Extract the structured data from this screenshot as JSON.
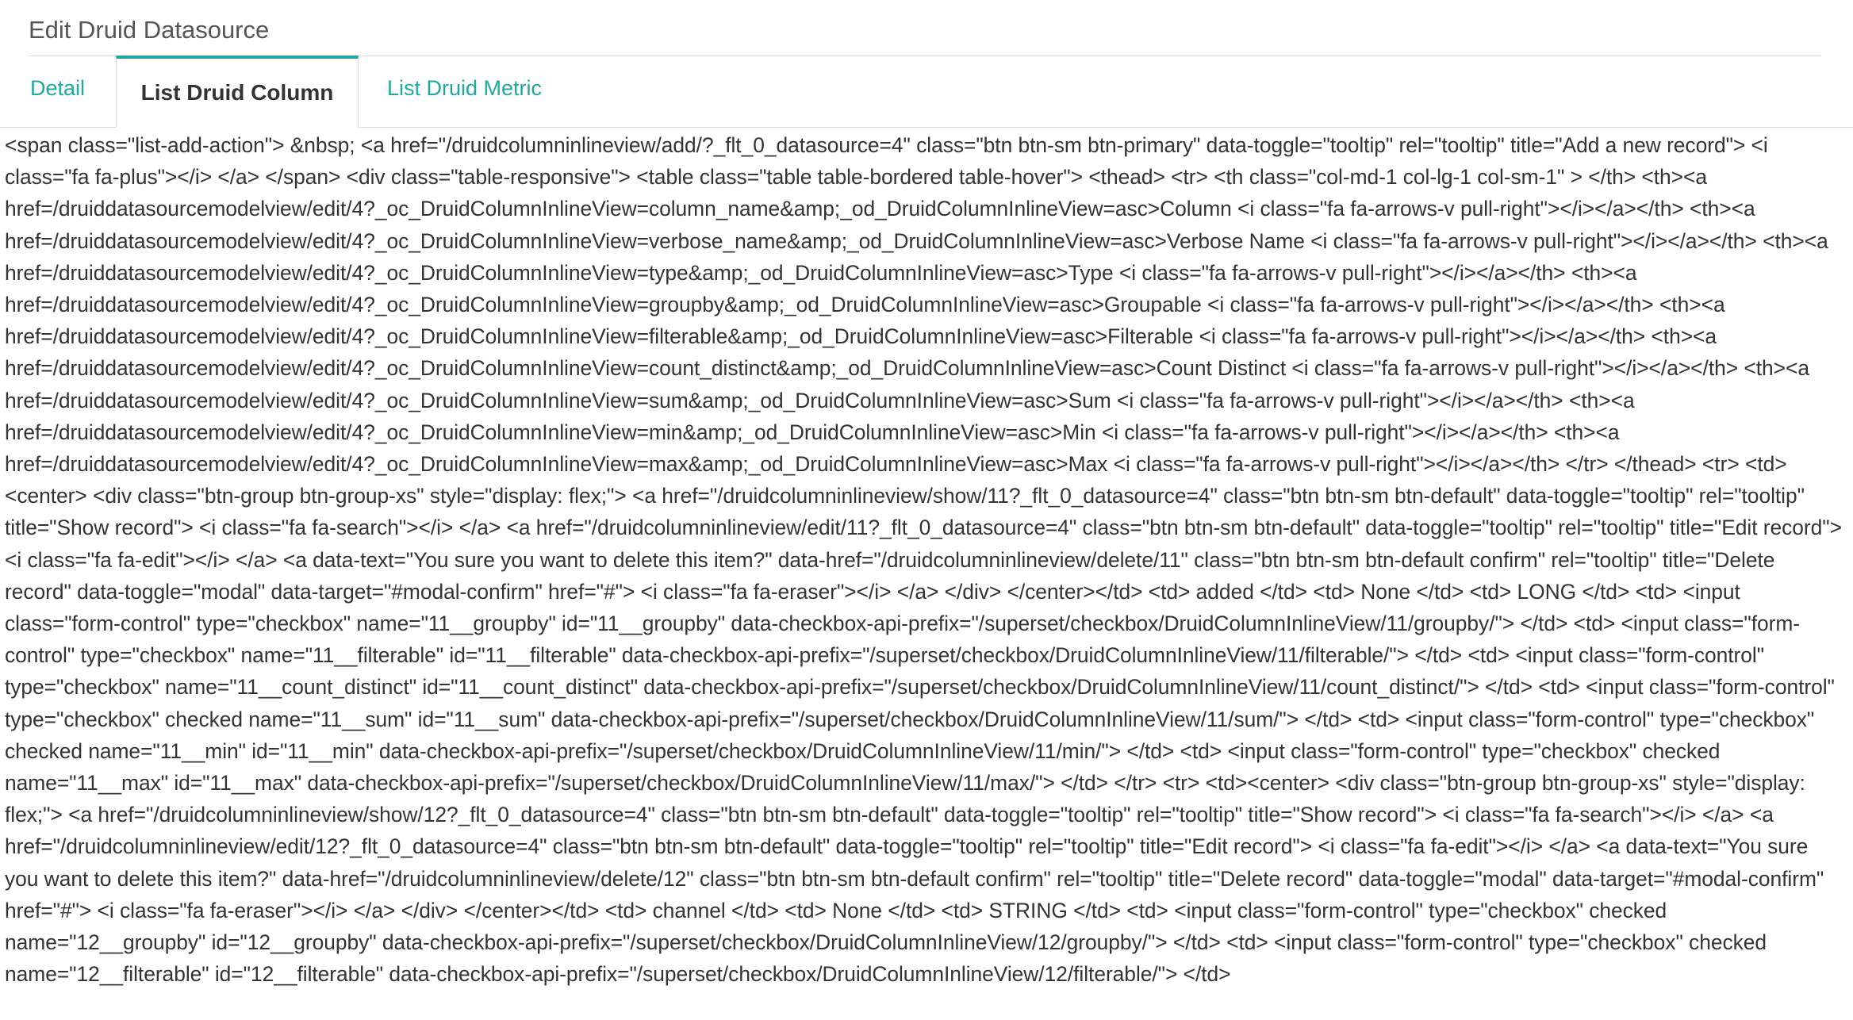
{
  "header": {
    "title": "Edit Druid Datasource"
  },
  "tabs": [
    {
      "label": "Detail"
    },
    {
      "label": "List Druid Column"
    },
    {
      "label": "List Druid Metric"
    }
  ],
  "active_tab": "List Druid Column",
  "accent_color": "#1fa8a0",
  "content": {
    "raw_html_text": "<span class=\"list-add-action\"> &nbsp; <a href=\"/druidcolumninlineview/add/?_flt_0_datasource=4\" class=\"btn btn-sm btn-primary\" data-toggle=\"tooltip\" rel=\"tooltip\" title=\"Add a new record\"> <i class=\"fa fa-plus\"></i> </a> </span> <div class=\"table-responsive\"> <table class=\"table table-bordered table-hover\"> <thead> <tr> <th class=\"col-md-1 col-lg-1 col-sm-1\" > </th> <th><a href=/druiddatasourcemodelview/edit/4?_oc_DruidColumnInlineView=column_name&amp;_od_DruidColumnInlineView=asc>Column <i class=\"fa fa-arrows-v pull-right\"></i></a></th> <th><a href=/druiddatasourcemodelview/edit/4?_oc_DruidColumnInlineView=verbose_name&amp;_od_DruidColumnInlineView=asc>Verbose Name <i class=\"fa fa-arrows-v pull-right\"></i></a></th> <th><a href=/druiddatasourcemodelview/edit/4?_oc_DruidColumnInlineView=type&amp;_od_DruidColumnInlineView=asc>Type <i class=\"fa fa-arrows-v pull-right\"></i></a></th> <th><a href=/druiddatasourcemodelview/edit/4?_oc_DruidColumnInlineView=groupby&amp;_od_DruidColumnInlineView=asc>Groupable <i class=\"fa fa-arrows-v pull-right\"></i></a></th> <th><a href=/druiddatasourcemodelview/edit/4?_oc_DruidColumnInlineView=filterable&amp;_od_DruidColumnInlineView=asc>Filterable <i class=\"fa fa-arrows-v pull-right\"></i></a></th> <th><a href=/druiddatasourcemodelview/edit/4?_oc_DruidColumnInlineView=count_distinct&amp;_od_DruidColumnInlineView=asc>Count Distinct <i class=\"fa fa-arrows-v pull-right\"></i></a></th> <th><a href=/druiddatasourcemodelview/edit/4?_oc_DruidColumnInlineView=sum&amp;_od_DruidColumnInlineView=asc>Sum <i class=\"fa fa-arrows-v pull-right\"></i></a></th> <th><a href=/druiddatasourcemodelview/edit/4?_oc_DruidColumnInlineView=min&amp;_od_DruidColumnInlineView=asc>Min <i class=\"fa fa-arrows-v pull-right\"></i></a></th> <th><a href=/druiddatasourcemodelview/edit/4?_oc_DruidColumnInlineView=max&amp;_od_DruidColumnInlineView=asc>Max <i class=\"fa fa-arrows-v pull-right\"></i></a></th> </tr> </thead> <tr> <td><center> <div class=\"btn-group btn-group-xs\" style=\"display: flex;\"> <a href=\"/druidcolumninlineview/show/11?_flt_0_datasource=4\" class=\"btn btn-sm btn-default\" data-toggle=\"tooltip\" rel=\"tooltip\" title=\"Show record\"> <i class=\"fa fa-search\"></i> </a> <a href=\"/druidcolumninlineview/edit/11?_flt_0_datasource=4\" class=\"btn btn-sm btn-default\" data-toggle=\"tooltip\" rel=\"tooltip\" title=\"Edit record\"> <i class=\"fa fa-edit\"></i> </a> <a data-text=\"You sure you want to delete this item?\" data-href=\"/druidcolumninlineview/delete/11\" class=\"btn btn-sm btn-default confirm\" rel=\"tooltip\" title=\"Delete record\" data-toggle=\"modal\" data-target=\"#modal-confirm\" href=\"#\"> <i class=\"fa fa-eraser\"></i> </a> </div> </center></td> <td> added </td> <td> None </td> <td> LONG </td> <td> <input class=\"form-control\" type=\"checkbox\" name=\"11__groupby\" id=\"11__groupby\" data-checkbox-api-prefix=\"/superset/checkbox/DruidColumnInlineView/11/groupby/\"> </td> <td> <input class=\"form-control\" type=\"checkbox\" name=\"11__filterable\" id=\"11__filterable\" data-checkbox-api-prefix=\"/superset/checkbox/DruidColumnInlineView/11/filterable/\"> </td> <td> <input class=\"form-control\" type=\"checkbox\" name=\"11__count_distinct\" id=\"11__count_distinct\" data-checkbox-api-prefix=\"/superset/checkbox/DruidColumnInlineView/11/count_distinct/\"> </td> <td> <input class=\"form-control\" type=\"checkbox\" checked name=\"11__sum\" id=\"11__sum\" data-checkbox-api-prefix=\"/superset/checkbox/DruidColumnInlineView/11/sum/\"> </td> <td> <input class=\"form-control\" type=\"checkbox\" checked name=\"11__min\" id=\"11__min\" data-checkbox-api-prefix=\"/superset/checkbox/DruidColumnInlineView/11/min/\"> </td> <td> <input class=\"form-control\" type=\"checkbox\" checked name=\"11__max\" id=\"11__max\" data-checkbox-api-prefix=\"/superset/checkbox/DruidColumnInlineView/11/max/\"> </td> </tr> <tr> <td><center> <div class=\"btn-group btn-group-xs\" style=\"display: flex;\"> <a href=\"/druidcolumninlineview/show/12?_flt_0_datasource=4\" class=\"btn btn-sm btn-default\" data-toggle=\"tooltip\" rel=\"tooltip\" title=\"Show record\"> <i class=\"fa fa-search\"></i> </a> <a href=\"/druidcolumninlineview/edit/12?_flt_0_datasource=4\" class=\"btn btn-sm btn-default\" data-toggle=\"tooltip\" rel=\"tooltip\" title=\"Edit record\"> <i class=\"fa fa-edit\"></i> </a> <a data-text=\"You sure you want to delete this item?\" data-href=\"/druidcolumninlineview/delete/12\" class=\"btn btn-sm btn-default confirm\" rel=\"tooltip\" title=\"Delete record\" data-toggle=\"modal\" data-target=\"#modal-confirm\" href=\"#\"> <i class=\"fa fa-eraser\"></i> </a> </div> </center></td> <td> channel </td> <td> None </td> <td> STRING </td> <td> <input class=\"form-control\" type=\"checkbox\" checked name=\"12__groupby\" id=\"12__groupby\" data-checkbox-api-prefix=\"/superset/checkbox/DruidColumnInlineView/12/groupby/\"> </td> <td> <input class=\"form-control\" type=\"checkbox\" checked name=\"12__filterable\" id=\"12__filterable\" data-checkbox-api-prefix=\"/superset/checkbox/DruidColumnInlineView/12/filterable/\"> </td>"
  }
}
